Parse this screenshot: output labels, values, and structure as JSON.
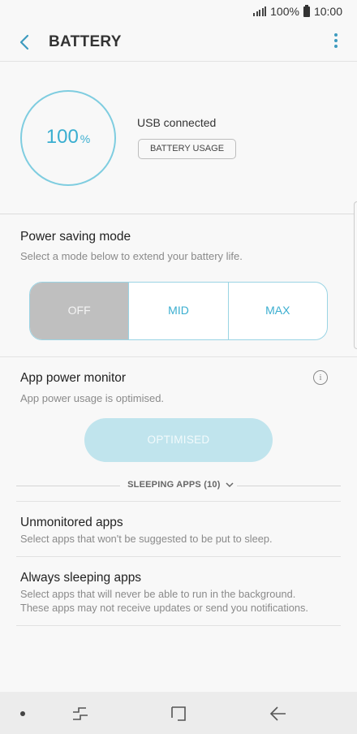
{
  "status_bar": {
    "battery": "100%",
    "time": "10:00",
    "icons": [
      "signal-icon",
      "battery-icon"
    ]
  },
  "header": {
    "title": "BATTERY",
    "back_icon": "back-arrow-icon",
    "menu_icon": "more-options-icon"
  },
  "battery": {
    "percent_value": "100",
    "percent_unit": "%",
    "charge_level": 100,
    "status": "USB connected",
    "usage_button": "BATTERY USAGE"
  },
  "power_saving": {
    "title": "Power saving mode",
    "subtitle": "Select a mode below to extend your battery life.",
    "modes": [
      "OFF",
      "MID",
      "MAX"
    ],
    "selected": "OFF"
  },
  "app_power_monitor": {
    "title": "App power monitor",
    "subtitle": "App power usage is optimised.",
    "button": "OPTIMISED",
    "info_icon": "info-icon",
    "info_glyph": "i"
  },
  "sleeping_apps": {
    "label": "SLEEPING APPS (10)",
    "icon": "chevron-down-icon"
  },
  "list": [
    {
      "title": "Unmonitored apps",
      "subtitle_lines": [
        "Select apps that won't be suggested to be put to sleep."
      ]
    },
    {
      "title": "Always sleeping apps",
      "subtitle_lines": [
        "Select apps that will never be able to run in the background.",
        "These apps may not receive updates or send you notifications."
      ]
    }
  ],
  "nav_bar": {
    "icons": [
      "nav-dot-icon",
      "recent-apps-icon",
      "home-icon",
      "back-icon"
    ]
  },
  "colors": {
    "accent": "#3aaed0",
    "circle": "#7fcde0",
    "active_mode": "#bfbfbf",
    "optimised_button": "#c0e4ed",
    "background": "#f8f8f8",
    "nav_bar": "#ececec"
  }
}
